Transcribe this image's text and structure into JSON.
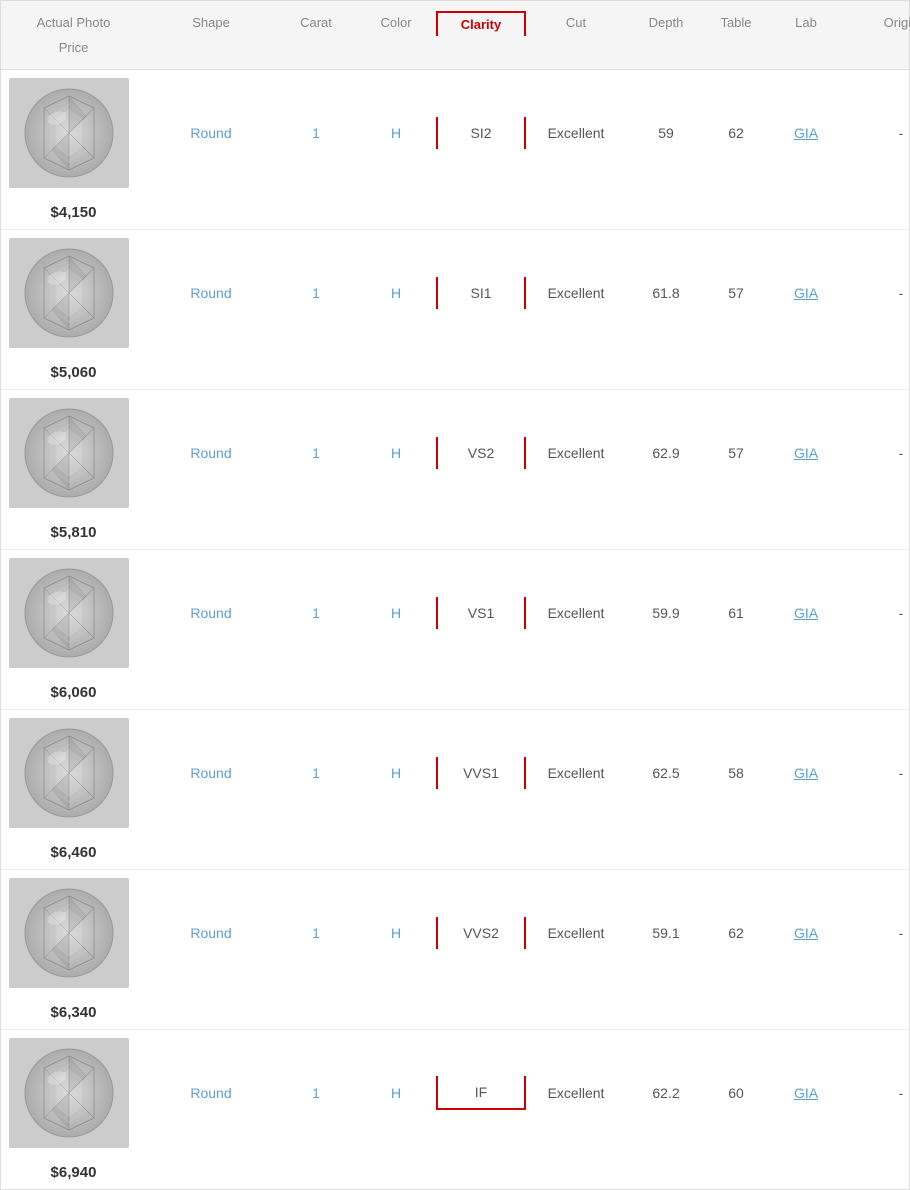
{
  "header": {
    "columns": [
      {
        "id": "photo",
        "label": "Actual Photo"
      },
      {
        "id": "shape",
        "label": "Shape"
      },
      {
        "id": "carat",
        "label": "Carat"
      },
      {
        "id": "color",
        "label": "Color"
      },
      {
        "id": "clarity",
        "label": "Clarity"
      },
      {
        "id": "cut",
        "label": "Cut"
      },
      {
        "id": "depth",
        "label": "Depth"
      },
      {
        "id": "table",
        "label": "Table"
      },
      {
        "id": "lab",
        "label": "Lab"
      },
      {
        "id": "origin",
        "label": "Origin"
      },
      {
        "id": "price",
        "label": "Price"
      }
    ]
  },
  "rows": [
    {
      "shape": "Round",
      "carat": "1",
      "color": "H",
      "clarity": "SI2",
      "cut": "Excellent",
      "depth": "59",
      "table": "62",
      "lab": "GIA",
      "origin": "-",
      "price": "$4,150"
    },
    {
      "shape": "Round",
      "carat": "1",
      "color": "H",
      "clarity": "SI1",
      "cut": "Excellent",
      "depth": "61.8",
      "table": "57",
      "lab": "GIA",
      "origin": "-",
      "price": "$5,060"
    },
    {
      "shape": "Round",
      "carat": "1",
      "color": "H",
      "clarity": "VS2",
      "cut": "Excellent",
      "depth": "62.9",
      "table": "57",
      "lab": "GIA",
      "origin": "-",
      "price": "$5,810"
    },
    {
      "shape": "Round",
      "carat": "1",
      "color": "H",
      "clarity": "VS1",
      "cut": "Excellent",
      "depth": "59.9",
      "table": "61",
      "lab": "GIA",
      "origin": "-",
      "price": "$6,060"
    },
    {
      "shape": "Round",
      "carat": "1",
      "color": "H",
      "clarity": "VVS1",
      "cut": "Excellent",
      "depth": "62.5",
      "table": "58",
      "lab": "GIA",
      "origin": "-",
      "price": "$6,460"
    },
    {
      "shape": "Round",
      "carat": "1",
      "color": "H",
      "clarity": "VVS2",
      "cut": "Excellent",
      "depth": "59.1",
      "table": "62",
      "lab": "GIA",
      "origin": "-",
      "price": "$6,340"
    },
    {
      "shape": "Round",
      "carat": "1",
      "color": "H",
      "clarity": "IF",
      "cut": "Excellent",
      "depth": "62.2",
      "table": "60",
      "lab": "GIA",
      "origin": "-",
      "price": "$6,940"
    }
  ],
  "colors": {
    "highlight_border": "#cc0000",
    "blue_text": "#5a9fd4",
    "header_bg": "#f5f5f5"
  }
}
